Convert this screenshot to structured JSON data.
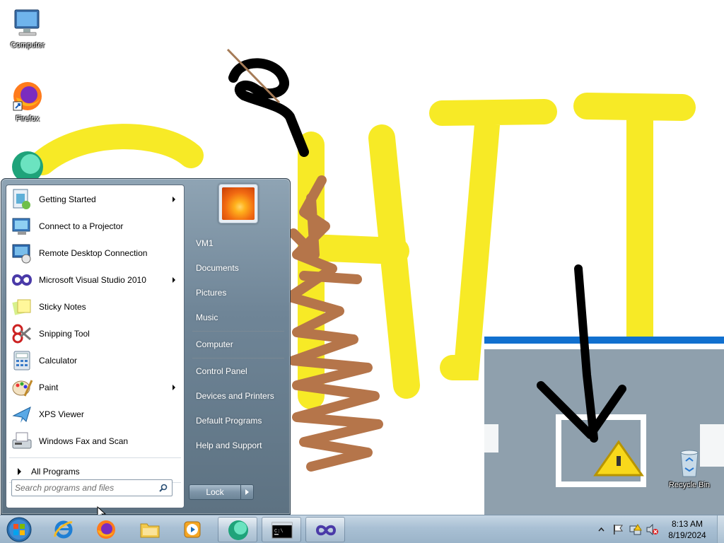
{
  "desktop": {
    "icons": [
      {
        "label": "Computer",
        "icon": "computer-icon"
      },
      {
        "label": "Firefox",
        "icon": "firefox-icon"
      },
      {
        "label": "",
        "icon": "app-icon"
      },
      {
        "label": "Recycle Bin",
        "icon": "recycle-bin-icon"
      }
    ]
  },
  "start_menu": {
    "programs": [
      {
        "label": "Getting Started",
        "icon": "getting-started-icon",
        "submenu": true
      },
      {
        "label": "Connect to a Projector",
        "icon": "projector-icon",
        "submenu": false
      },
      {
        "label": "Remote Desktop Connection",
        "icon": "remote-desktop-icon",
        "submenu": false
      },
      {
        "label": "Microsoft Visual Studio 2010",
        "icon": "visual-studio-icon",
        "submenu": true
      },
      {
        "label": "Sticky Notes",
        "icon": "sticky-notes-icon",
        "submenu": false
      },
      {
        "label": "Snipping Tool",
        "icon": "snipping-tool-icon",
        "submenu": false
      },
      {
        "label": "Calculator",
        "icon": "calculator-icon",
        "submenu": false
      },
      {
        "label": "Paint",
        "icon": "paint-icon",
        "submenu": true
      },
      {
        "label": "XPS Viewer",
        "icon": "xps-viewer-icon",
        "submenu": false
      },
      {
        "label": "Windows Fax and Scan",
        "icon": "fax-scan-icon",
        "submenu": false
      }
    ],
    "all_programs_label": "All Programs",
    "search_placeholder": "Search programs and files",
    "right_items": [
      "VM1",
      "Documents",
      "Pictures",
      "Music",
      "Computer",
      "Control Panel",
      "Devices and Printers",
      "Default Programs",
      "Help and Support"
    ],
    "lock_label": "Lock"
  },
  "taskbar": {
    "pinned": [
      {
        "name": "internet-explorer",
        "icon": "ie-icon"
      },
      {
        "name": "firefox",
        "icon": "firefox-icon"
      },
      {
        "name": "file-explorer",
        "icon": "folder-icon"
      },
      {
        "name": "media-player",
        "icon": "media-player-icon"
      },
      {
        "name": "app",
        "icon": "app-icon",
        "active": true
      },
      {
        "name": "command-prompt",
        "icon": "cmd-icon"
      },
      {
        "name": "visual-studio",
        "icon": "visual-studio-icon"
      }
    ],
    "clock": {
      "time": "8:13 AM",
      "date": "8/19/2024"
    }
  },
  "colors": {
    "yellow_paint": "#f7e91a",
    "brown_paint": "#b5754a",
    "start_menu_glass": "#7a8fa1",
    "taskbar": "#aec4d7"
  }
}
